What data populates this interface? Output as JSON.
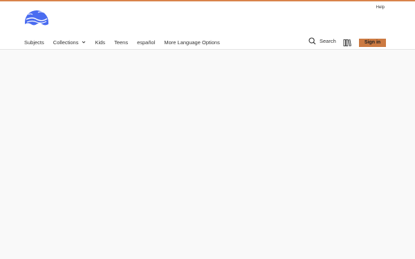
{
  "colors": {
    "accent_bar": "#d9834a",
    "logo_blue": "#4a6cf0",
    "sign_in_bg": "#cc7a42",
    "page_bg": "#f9f9f9"
  },
  "header": {
    "help_label": "Help",
    "logo_icon": "wave-logo-icon"
  },
  "nav": {
    "items": [
      {
        "label": "Subjects"
      },
      {
        "label": "Collections",
        "icon": "chevron-down-icon"
      },
      {
        "label": "Kids"
      },
      {
        "label": "Teens"
      },
      {
        "label": "español"
      },
      {
        "label": "More Language Options"
      }
    ]
  },
  "actions": {
    "search_label": "Search",
    "search_icon": "search-icon",
    "library_icon": "library-books-icon",
    "sign_in_label": "Sign in"
  }
}
